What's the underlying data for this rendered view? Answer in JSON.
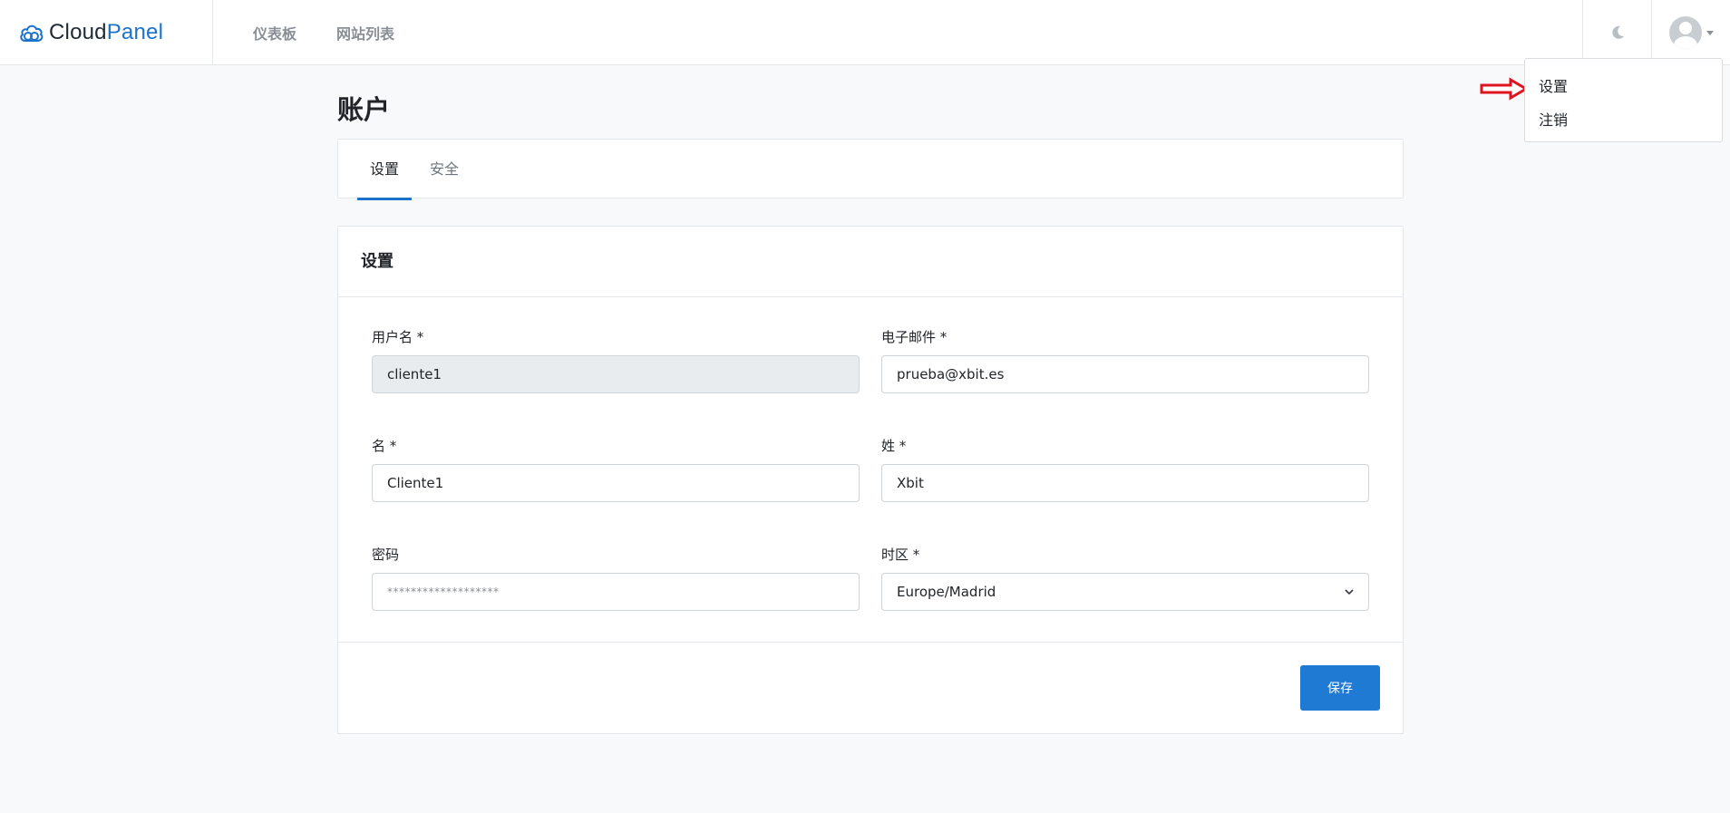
{
  "brand": {
    "name_part1": "Cloud",
    "name_part2": "Panel",
    "accent_color": "#1a73c9",
    "icon": "cloud-logo-icon"
  },
  "nav": {
    "items": [
      {
        "label": "仪表板"
      },
      {
        "label": "网站列表"
      }
    ]
  },
  "header": {
    "theme_icon": "moon-icon",
    "user_icon": "avatar-icon"
  },
  "dropdown": {
    "items": [
      {
        "label": "设置"
      },
      {
        "label": "注销"
      }
    ],
    "pointer_icon": "red-arrow-icon"
  },
  "page": {
    "title": "账户"
  },
  "tabs": [
    {
      "label": "设置",
      "active": true
    },
    {
      "label": "安全",
      "active": false
    }
  ],
  "form": {
    "title": "设置",
    "username": {
      "label": "用户名 *",
      "value": "cliente1"
    },
    "email": {
      "label": "电子邮件 *",
      "value": "prueba@xbit.es"
    },
    "first_name": {
      "label": "名 *",
      "value": "Cliente1"
    },
    "last_name": {
      "label": "姓 *",
      "value": "Xbit"
    },
    "password": {
      "label": "密码",
      "placeholder": "*******************"
    },
    "timezone": {
      "label": "时区 *",
      "value": "Europe/Madrid"
    },
    "save_label": "保存",
    "save_color": "#1f7ad4"
  }
}
